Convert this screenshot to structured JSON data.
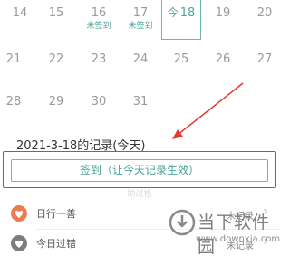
{
  "calendar": {
    "rows": [
      [
        {
          "day": "14",
          "status": ""
        },
        {
          "day": "15",
          "status": ""
        },
        {
          "day": "16",
          "status": "未签到"
        },
        {
          "day": "17",
          "status": "未签到"
        },
        {
          "day": "18",
          "status": "",
          "today": true,
          "today_mark": "今"
        },
        {
          "day": "19",
          "status": ""
        },
        {
          "day": "20",
          "status": ""
        }
      ],
      [
        {
          "day": "21",
          "status": ""
        },
        {
          "day": "22",
          "status": ""
        },
        {
          "day": "23",
          "status": ""
        },
        {
          "day": "24",
          "status": ""
        },
        {
          "day": "25",
          "status": ""
        },
        {
          "day": "26",
          "status": ""
        },
        {
          "day": "27",
          "status": ""
        }
      ],
      [
        {
          "day": "28",
          "status": ""
        },
        {
          "day": "29",
          "status": ""
        },
        {
          "day": "30",
          "status": ""
        },
        {
          "day": "31",
          "status": ""
        }
      ]
    ]
  },
  "record": {
    "date_title": "2021-3-18的记录(今天)",
    "sign_button": "签到（让今天记录生效）",
    "faint_text": "助过格"
  },
  "list": [
    {
      "label": "日行一善",
      "status": "未记录",
      "icon": "heart-icon",
      "color": "#f07b4e"
    },
    {
      "label": "今日过错",
      "status": "未记录",
      "icon": "heart-icon",
      "color": "#7d7d7d"
    }
  ],
  "watermark": {
    "name": "当下软件园",
    "url": "www.downxia.com",
    "icon": "download-logo-icon"
  },
  "colors": {
    "accent": "#4aa89c",
    "highlight": "#e4392f"
  }
}
